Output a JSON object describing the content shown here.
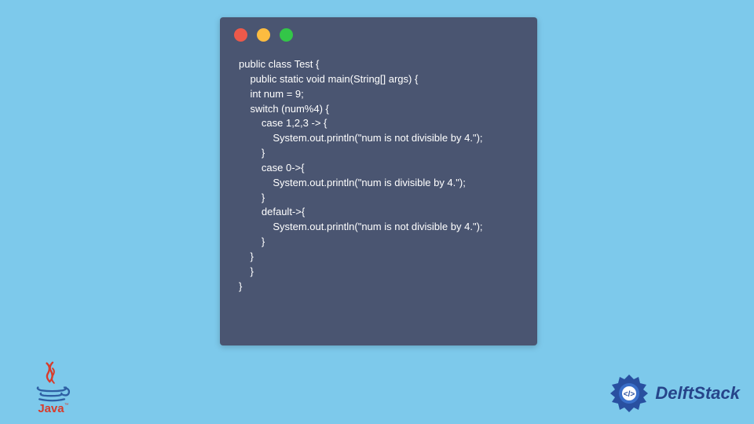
{
  "code": {
    "lines": [
      "public class Test {",
      "    public static void main(String[] args) {",
      "    int num = 9;",
      "    switch (num%4) {",
      "        case 1,2,3 -> {",
      "            System.out.println(\"num is not divisible by 4.\");",
      "        }",
      "        case 0->{",
      "            System.out.println(\"num is divisible by 4.\");",
      "        }",
      "        default->{",
      "            System.out.println(\"num is not divisible by 4.\");",
      "        }",
      "    }",
      "    }",
      "}"
    ]
  },
  "logos": {
    "java_label": "Java",
    "delftstack_label": "DelftStack"
  },
  "colors": {
    "background": "#7dc9eb",
    "code_bg": "#4a5571",
    "code_text": "#ffffff",
    "dot_red": "#ed594a",
    "dot_yellow": "#fdbc40",
    "dot_green": "#33c648",
    "delft_blue": "#26448a"
  }
}
